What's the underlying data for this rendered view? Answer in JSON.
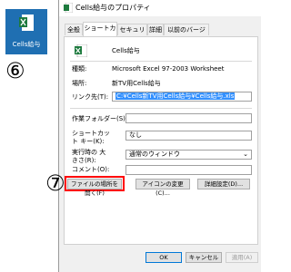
{
  "desktop_icon": {
    "label": "Cells給与"
  },
  "callouts": {
    "step6": "⑥",
    "step7": "⑦"
  },
  "dialog": {
    "title": "Cells給与のプロパティ",
    "tabs": [
      "全般",
      "ショートカット",
      "セキュリティ",
      "詳細",
      "以前のバージョン"
    ],
    "active_tab": 1,
    "shortcut_name": "Cells給与",
    "rows": {
      "type_label": "種類:",
      "type_value": "Microsoft Excel 97-2003 Worksheet",
      "location_label": "場所:",
      "location_value": "新TV用Cells給与",
      "target_label": "リンク先(T):",
      "target_value": "C:¥Cells新TV用Cells給与¥Cells給与.xls",
      "workdir_label": "作業フォルダー(S):",
      "workdir_value": "",
      "shortcutkey_label": "ショートカット キー(K):",
      "shortcutkey_value": "なし",
      "runsize_label": "実行時の 大きさ(R):",
      "runsize_value": "通常のウィンドウ",
      "comment_label": "コメント(O):",
      "comment_value": ""
    },
    "buttons": {
      "open_location": "ファイルの場所を開く(F)",
      "change_icon": "アイコンの変更(C)...",
      "advanced": "詳細設定(D)..."
    },
    "footer": {
      "ok": "OK",
      "cancel": "キャンセル",
      "apply": "適用(A)"
    }
  },
  "colors": {
    "highlight": "#3390ff",
    "callout_box": "#ff0000",
    "icon_bg": "#1f6fb2"
  }
}
